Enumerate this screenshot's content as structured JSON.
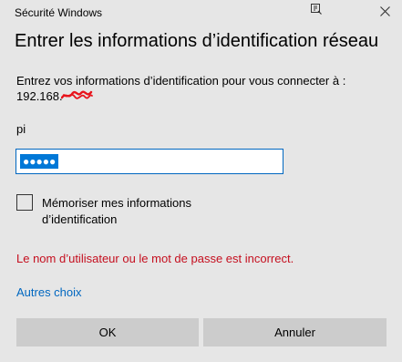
{
  "window": {
    "title": "Sécurité Windows"
  },
  "dialog": {
    "heading": "Entrer les informations d’identification réseau",
    "instructions": "Entrez vos informations d’identification pour vous connecter à :",
    "address_visible": "192.168."
  },
  "form": {
    "username": "pi",
    "password_masked": "●●●●●",
    "remember_label": "Mémoriser mes informations d’identification",
    "remember_checked": false
  },
  "error": {
    "message": "Le nom d’utilisateur ou le mot de passe est incorrect."
  },
  "links": {
    "more_choices": "Autres choix"
  },
  "buttons": {
    "ok": "OK",
    "cancel": "Annuler"
  },
  "colors": {
    "background": "#e6e6e6",
    "accent": "#0067c0",
    "selection": "#0078d7",
    "error": "#c50f1f",
    "button": "#cccccc"
  }
}
